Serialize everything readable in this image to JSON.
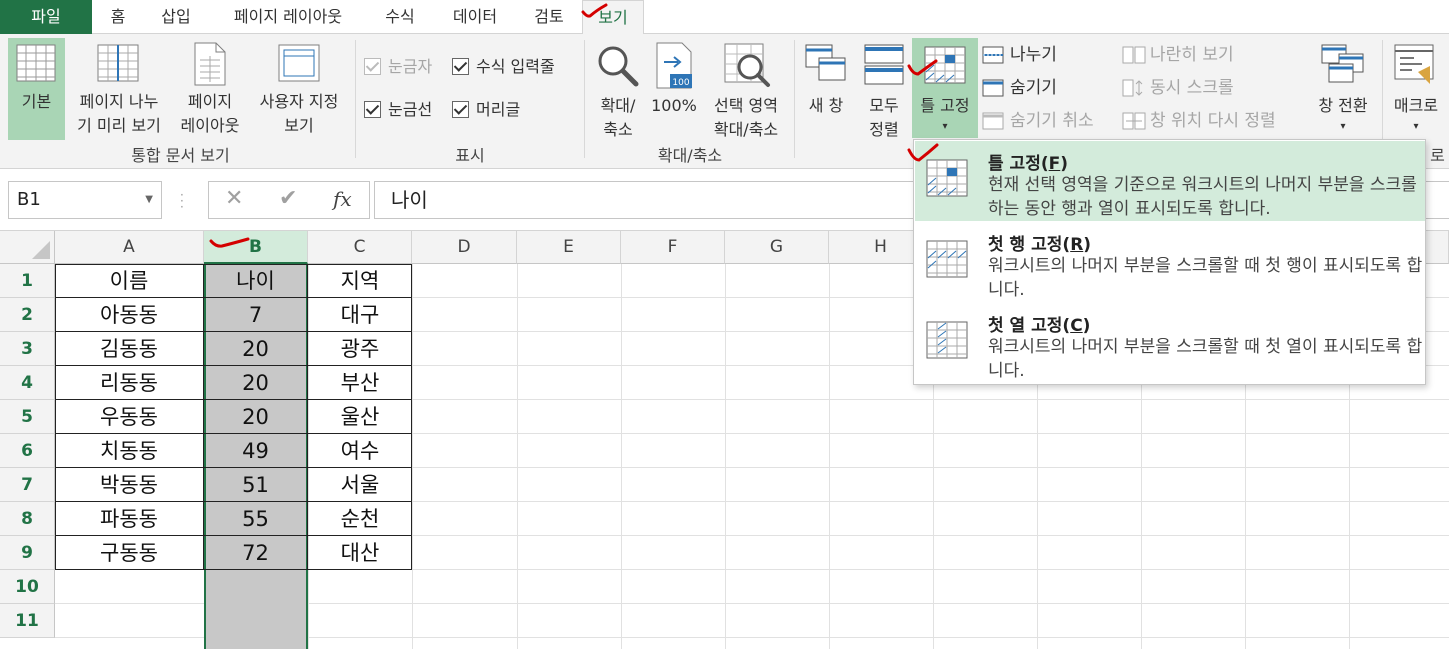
{
  "tabs": [
    {
      "label": "파일"
    },
    {
      "label": "홈"
    },
    {
      "label": "삽입"
    },
    {
      "label": "페이지 레이아웃"
    },
    {
      "label": "수식"
    },
    {
      "label": "데이터"
    },
    {
      "label": "검토"
    },
    {
      "label": "보기"
    }
  ],
  "ribbon": {
    "workbook_views": {
      "normal": "기본",
      "page_break_1": "페이지 나누",
      "page_break_2": "기 미리 보기",
      "page_layout_1": "페이지",
      "page_layout_2": "레이아웃",
      "custom_1": "사용자 지정",
      "custom_2": "보기",
      "group": "통합 문서 보기"
    },
    "show": {
      "ruler": "눈금자",
      "formula_bar": "수식 입력줄",
      "gridlines": "눈금선",
      "headings": "머리글",
      "group": "표시"
    },
    "zoom": {
      "zoom_1": "확대/",
      "zoom_2": "축소",
      "hundred": "100%",
      "sel_1": "선택 영역",
      "sel_2": "확대/축소",
      "group": "확대/축소"
    },
    "window": {
      "new_window": "새 창",
      "arrange_1": "모두",
      "arrange_2": "정렬",
      "freeze": "틀 고정",
      "split": "나누기",
      "hide": "숨기기",
      "unhide": "숨기기 취소",
      "side_by_side": "나란히 보기",
      "sync_scroll": "동시 스크롤",
      "reset_pos": "창 위치 다시 정렬",
      "switch": "창 전환",
      "group_tail": "로"
    },
    "macros": {
      "label": "매크로"
    }
  },
  "formula_bar": {
    "name_box": "B1",
    "cancel": "✕",
    "enter": "✔",
    "fx": "fx",
    "value": "나이"
  },
  "columns": [
    "A",
    "B",
    "C",
    "D",
    "E",
    "F",
    "G",
    "H"
  ],
  "rows": [
    "1",
    "2",
    "3",
    "4",
    "5",
    "6",
    "7",
    "8",
    "9",
    "10",
    "11"
  ],
  "table": [
    [
      "이름",
      "나이",
      "지역"
    ],
    [
      "아동동",
      "7",
      "대구"
    ],
    [
      "김동동",
      "20",
      "광주"
    ],
    [
      "리동동",
      "20",
      "부산"
    ],
    [
      "우동동",
      "20",
      "울산"
    ],
    [
      "치동동",
      "49",
      "여수"
    ],
    [
      "박동동",
      "51",
      "서울"
    ],
    [
      "파동동",
      "55",
      "순천"
    ],
    [
      "구동동",
      "72",
      "대산"
    ]
  ],
  "freeze_menu": [
    {
      "title": "틀 고정",
      "key": "F",
      "desc": "현재 선택 영역을 기준으로 워크시트의 나머지 부분을 스크롤하는 동안 행과 열이 표시되도록 합니다."
    },
    {
      "title": "첫 행 고정",
      "key": "R",
      "desc": "워크시트의 나머지 부분을 스크롤할 때 첫 행이 표시되도록 합니다."
    },
    {
      "title": "첫 열 고정",
      "key": "C",
      "desc": "워크시트의 나머지 부분을 스크롤할 때 첫 열이 표시되도록 합니다."
    }
  ],
  "colors": {
    "accent": "#217346",
    "selection": "#a9d5b5",
    "highlight": "#d3ebdb",
    "selected_column": "#c8c8c8",
    "annotation": "#d40000"
  }
}
